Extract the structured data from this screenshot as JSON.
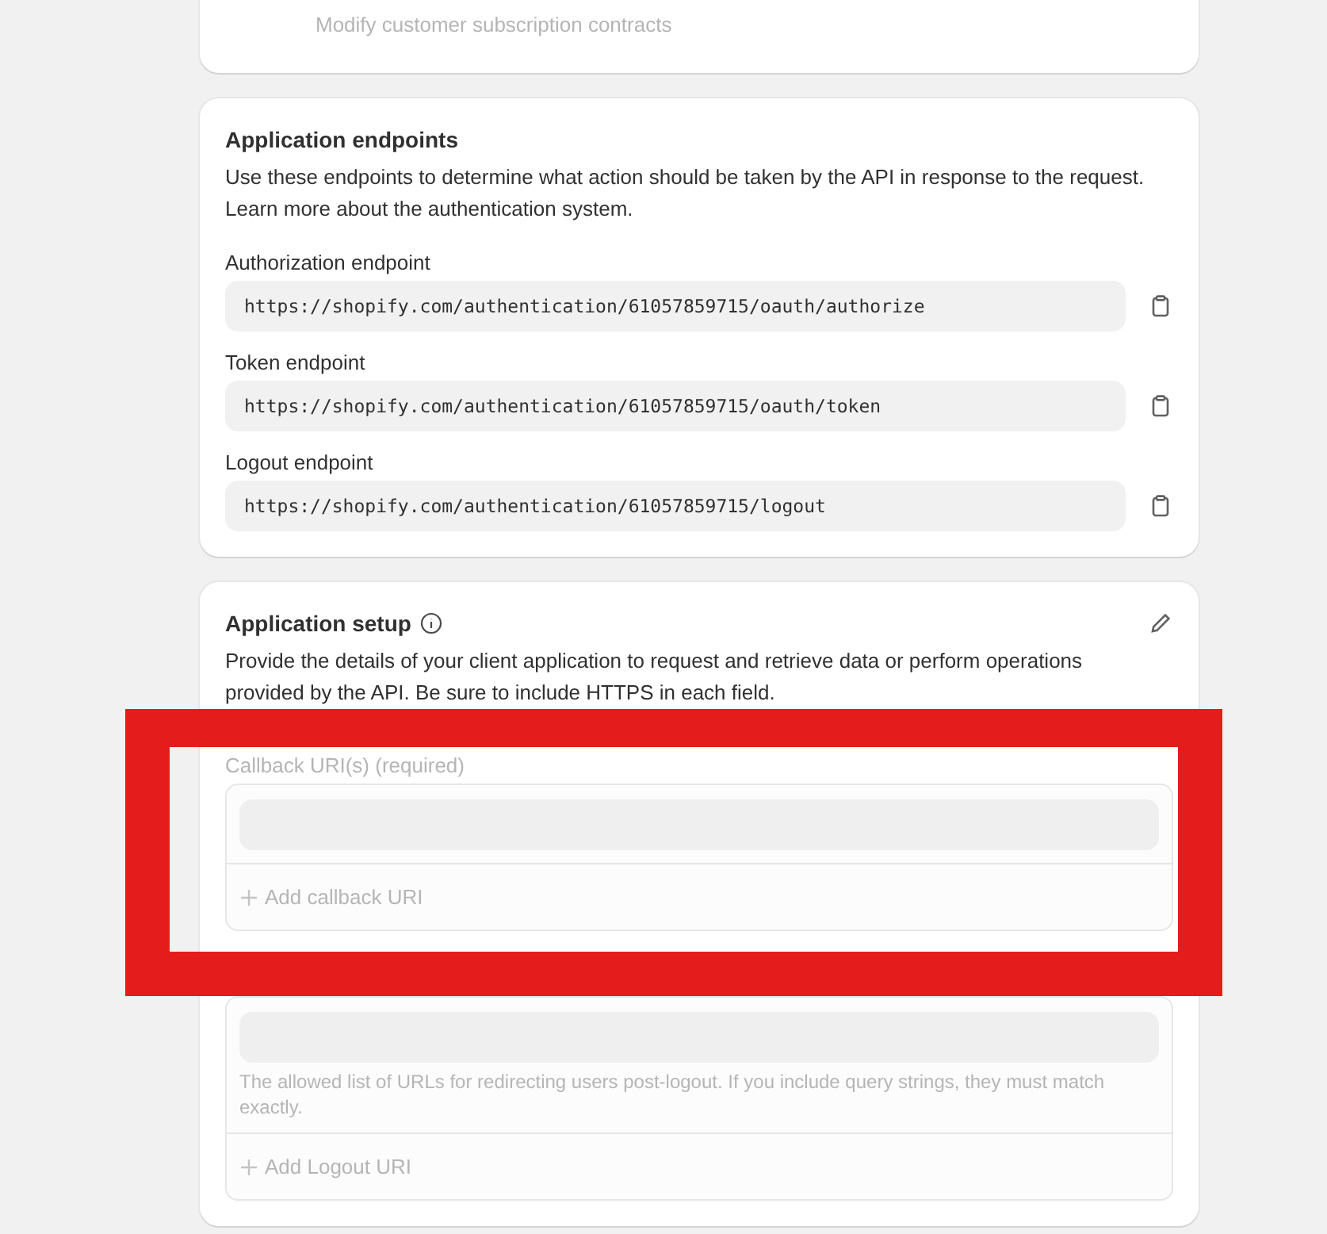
{
  "scope_card": {
    "description": "Modify customer subscription contracts"
  },
  "endpoints": {
    "title": "Application endpoints",
    "description": "Use these endpoints to determine what action should be taken by the API in response to the request. Learn more about the authentication system.",
    "items": [
      {
        "label": "Authorization endpoint",
        "value": "https://shopify.com/authentication/61057859715/oauth/authorize"
      },
      {
        "label": "Token endpoint",
        "value": "https://shopify.com/authentication/61057859715/oauth/token"
      },
      {
        "label": "Logout endpoint",
        "value": "https://shopify.com/authentication/61057859715/logout"
      }
    ]
  },
  "setup": {
    "title": "Application setup",
    "description": "Provide the details of your client application to request and retrieve data or perform operations provided by the API. Be sure to include HTTPS in each field.",
    "groups": [
      {
        "label": "Callback URI(s) (required)",
        "add_label": "Add callback URI",
        "disabled": true
      },
      {
        "help": "The allowed list of URLs for redirecting users post-logout. If you include query strings, they must match exactly.",
        "add_label": "Add Logout URI",
        "disabled": true
      }
    ]
  },
  "highlight": {
    "shown": true
  }
}
